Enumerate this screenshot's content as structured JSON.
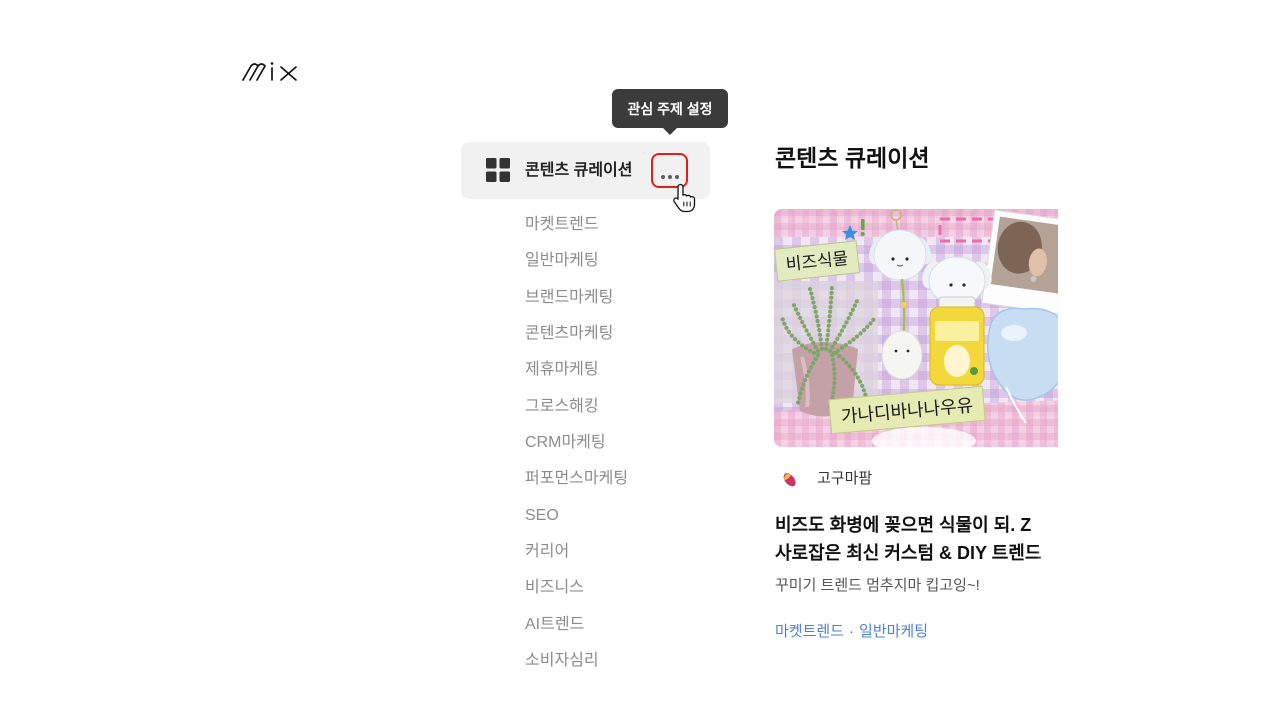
{
  "logo": {
    "text": "mix"
  },
  "tooltip": {
    "text": "관심 주제 설정"
  },
  "sidebar": {
    "active_item": {
      "label": "콘텐츠 큐레이션",
      "icon": "grid-icon",
      "more_button_icon": "more-dots-icon",
      "more_button_highlighted": true
    },
    "sub_items": [
      "마켓트렌드",
      "일반마케팅",
      "브랜드마케팅",
      "콘텐츠마케팅",
      "제휴마케팅",
      "그로스해킹",
      "CRM마케팅",
      "퍼포먼스마케팅",
      "SEO",
      "커리어",
      "비즈니스",
      "AI트렌드",
      "소비자심리"
    ]
  },
  "main": {
    "heading": "콘텐츠 큐레이션",
    "cards": [
      {
        "thumbnail": {
          "sticker_texts": [
            "비즈식물",
            "가나디바나나우유"
          ]
        },
        "author": {
          "name": "고구마팜",
          "icon": "sweet-potato-icon"
        },
        "title_lines": [
          "비즈도 화병에 꽂으면 식물이 되. Z",
          "사로잡은 최신 커스텀 & DIY 트렌드"
        ],
        "subtitle": "꾸미기 트렌드 멈추지마 킵고잉~!",
        "tags": [
          "마켓트렌드",
          "일반마케팅"
        ],
        "tag_separator": "·"
      }
    ]
  },
  "cursor": {
    "icon": "hand-pointer-icon"
  },
  "colors": {
    "tooltip_bg": "#3b3b3b",
    "active_item_bg": "#f1f1f1",
    "highlight_outline": "#e0211b",
    "muted_text": "#8c8c8c",
    "tag_link": "#4e7fd8"
  }
}
